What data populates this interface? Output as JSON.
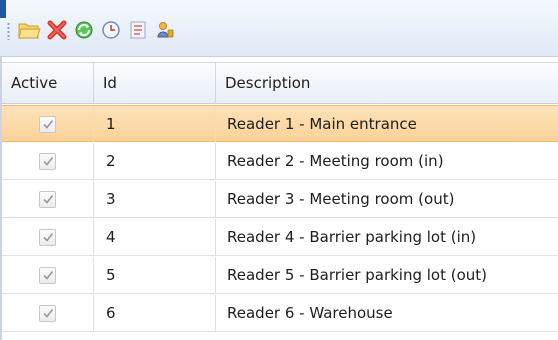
{
  "toolbar": {
    "buttons": [
      {
        "name": "open-folder-icon",
        "color": "#f2c84b"
      },
      {
        "name": "delete-icon",
        "color": "#d9342b"
      },
      {
        "name": "refresh-icon",
        "color": "#3aa33a"
      },
      {
        "name": "history-clock-icon",
        "color": "#6f8fb6"
      },
      {
        "name": "properties-list-icon",
        "color": "#9aa9bf"
      },
      {
        "name": "user-key-icon",
        "color": "#e8a82e"
      }
    ]
  },
  "grid": {
    "columns": [
      "Active",
      "Id",
      "Description"
    ],
    "rows": [
      {
        "active": true,
        "id": "1",
        "description": "Reader 1 - Main entrance",
        "selected": true
      },
      {
        "active": true,
        "id": "2",
        "description": "Reader 2 - Meeting room (in)",
        "selected": false
      },
      {
        "active": true,
        "id": "3",
        "description": "Reader 3 - Meeting room (out)",
        "selected": false
      },
      {
        "active": true,
        "id": "4",
        "description": "Reader 4 - Barrier parking lot (in)",
        "selected": false
      },
      {
        "active": true,
        "id": "5",
        "description": "Reader 5 - Barrier parking lot (out)",
        "selected": false
      },
      {
        "active": true,
        "id": "6",
        "description": "Reader 6 - Warehouse",
        "selected": false
      }
    ],
    "colors": {
      "selected_row": "#fbd39a",
      "header_bg": "#e9eff8",
      "grid_line": "#d9e1ec"
    }
  }
}
